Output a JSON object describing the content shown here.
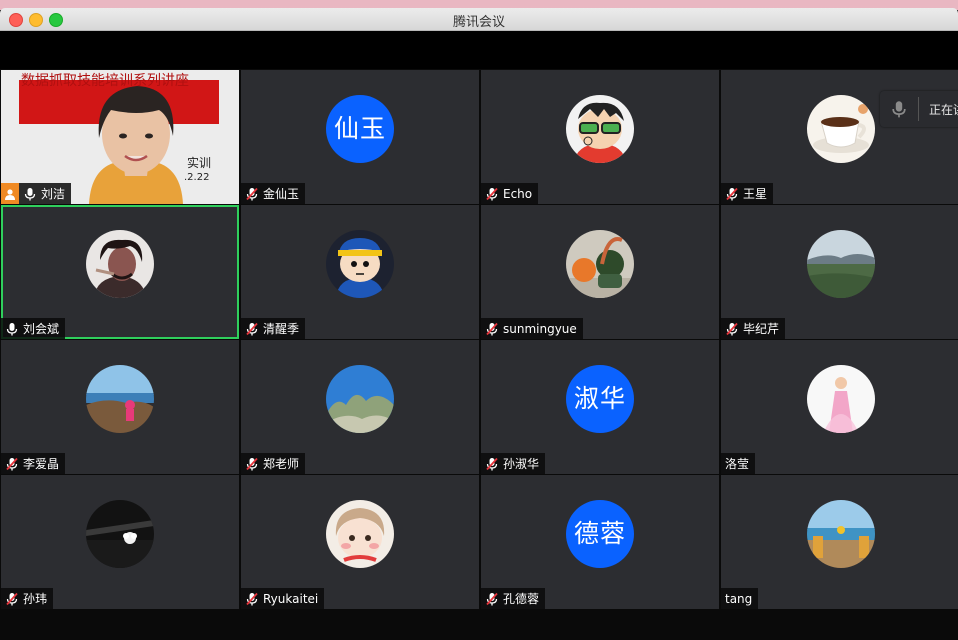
{
  "window": {
    "title": "腾讯会议"
  },
  "speaking": {
    "label": "正在讲"
  },
  "share": {
    "title": "数据抓取技能培训系列讲座",
    "subtitle": "实训",
    "date": ".2.22"
  },
  "participants": [
    {
      "name": "刘洁",
      "mic": "on",
      "host": true,
      "avatar": "screen-share"
    },
    {
      "name": "金仙玉",
      "mic": "off",
      "avatar": "text",
      "avatar_text": "仙玉"
    },
    {
      "name": "Echo",
      "mic": "off",
      "avatar": "cartoon-glasses"
    },
    {
      "name": "王星",
      "mic": "off",
      "avatar": "coffee-cup"
    },
    {
      "name": "刘会斌",
      "mic": "on",
      "active": true,
      "avatar": "portrait"
    },
    {
      "name": "清醒季",
      "mic": "off",
      "avatar": "cartoon-boy"
    },
    {
      "name": "sunmingyue",
      "mic": "off",
      "avatar": "orange-plant"
    },
    {
      "name": "毕纪芹",
      "mic": "off",
      "avatar": "landscape"
    },
    {
      "name": "李爱晶",
      "mic": "off",
      "avatar": "seaside"
    },
    {
      "name": "郑老师",
      "mic": "off",
      "avatar": "tree-sky"
    },
    {
      "name": "孙淑华",
      "mic": "off",
      "avatar": "text",
      "avatar_text": "淑华"
    },
    {
      "name": "洛莹",
      "mic": "none",
      "avatar": "girl-dress"
    },
    {
      "name": "孙玮",
      "mic": "off",
      "avatar": "night-flower"
    },
    {
      "name": "Ryukaitei",
      "mic": "off",
      "avatar": "cartoon-girl"
    },
    {
      "name": "孔德蓉",
      "mic": "off",
      "avatar": "text",
      "avatar_text": "德蓉"
    },
    {
      "name": "tang",
      "mic": "none",
      "avatar": "beach"
    }
  ],
  "colors": {
    "tile_bg": "#2c2d31",
    "active_border": "#2fcf5c",
    "text_avatar_bg": "#0a62ff",
    "mic_muted": "#e5343c",
    "host_badge": "#f08a24"
  }
}
